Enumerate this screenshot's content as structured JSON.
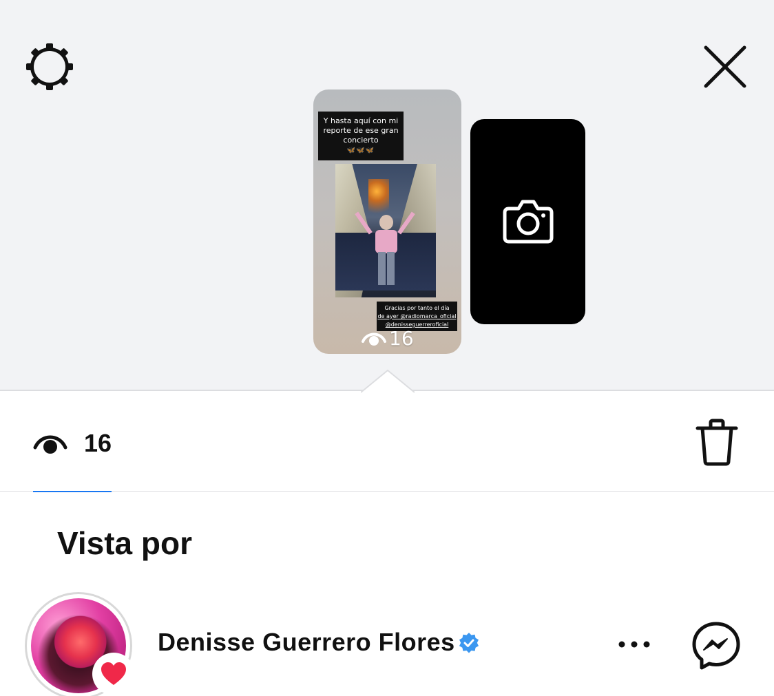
{
  "header": {
    "settings_icon": "gear-icon",
    "close_icon": "close-icon"
  },
  "story_card": {
    "caption_top": "Y hasta aquí con mi reporte de ese gran concierto",
    "caption_top_emoji": "🦋🦋🦋",
    "caption_bottom_1": "Gracias por tanto el día",
    "caption_bottom_2": "de ayer @radiomarca_oficial",
    "caption_bottom_3": "@denisseguerreroficial",
    "views": "16"
  },
  "camera_card": {
    "icon": "camera-icon"
  },
  "views_tab": {
    "icon": "eye-icon",
    "count": "16"
  },
  "trash_icon": "trash-icon",
  "section_title": "Vista por",
  "viewers": [
    {
      "name": "Denisse Guerrero Flores",
      "verified": true,
      "reaction": "heart",
      "accent": "#f02849"
    }
  ],
  "colors": {
    "accent_blue": "#1877f2",
    "verified_blue": "#3b97f0",
    "heart_red": "#f02849",
    "top_background": "#f2f3f5"
  }
}
